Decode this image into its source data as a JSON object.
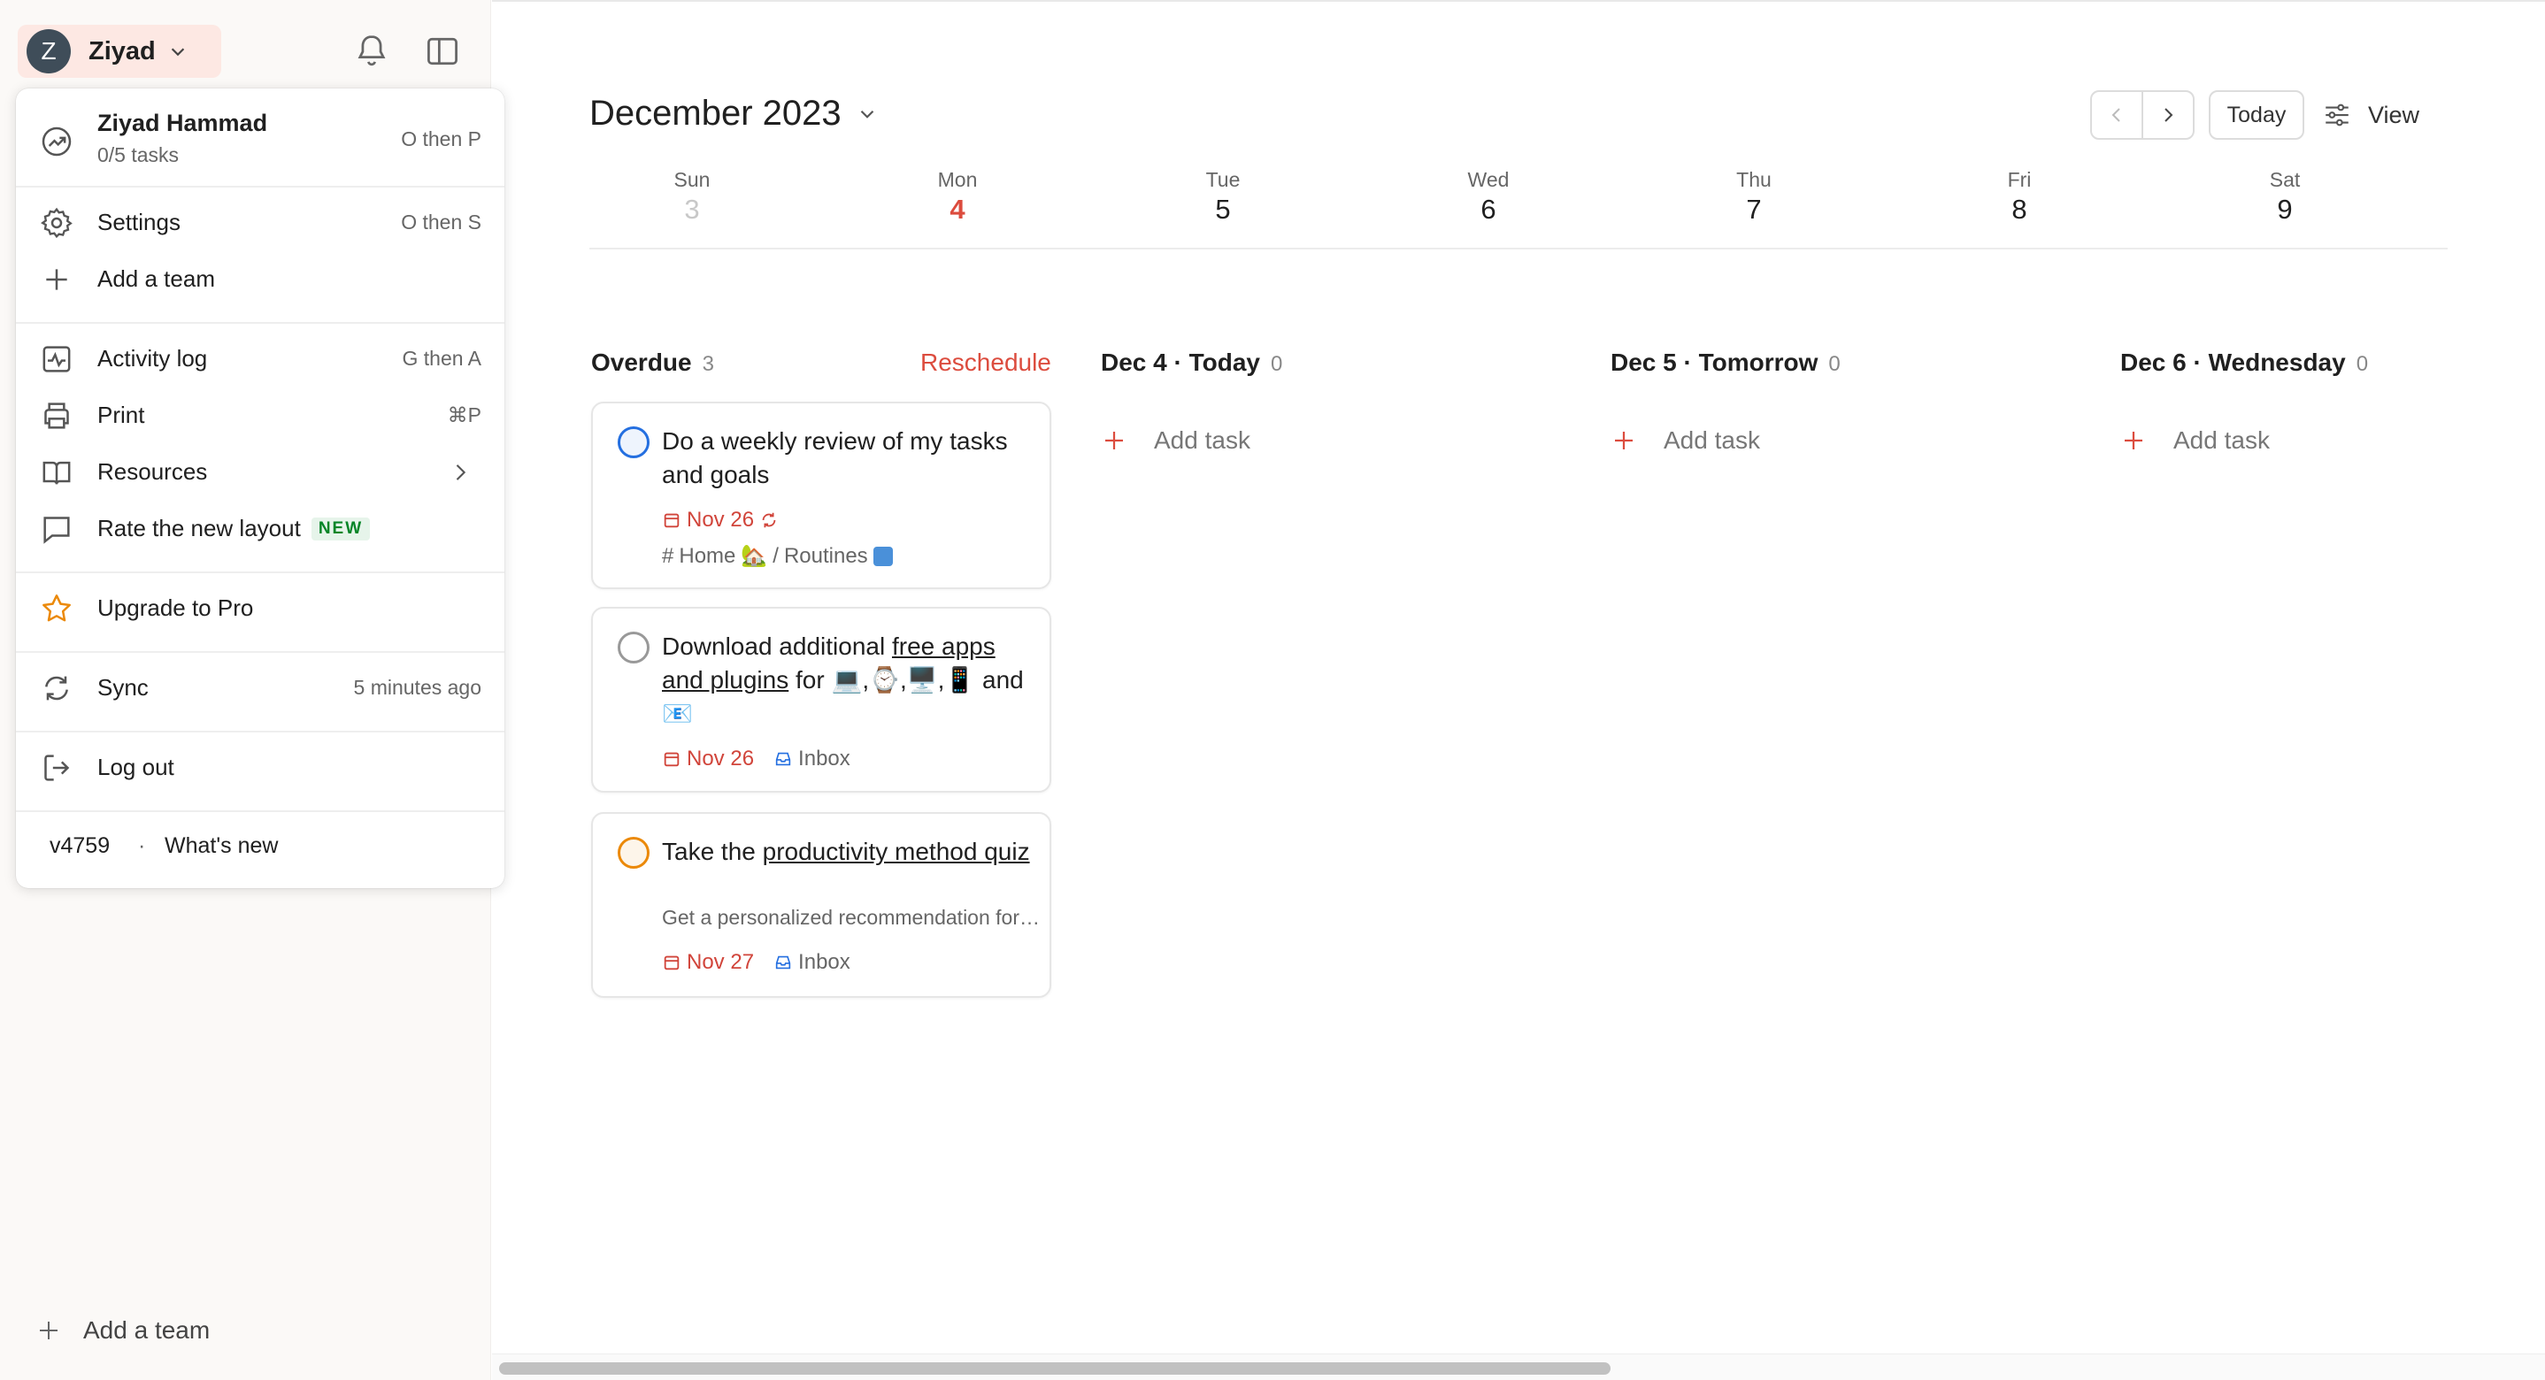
{
  "sidebar": {
    "user": {
      "initial": "Z",
      "name": "Ziyad"
    },
    "add_team_label": "Add a team"
  },
  "menu": {
    "profile": {
      "name": "Ziyad Hammad",
      "tasks": "0/5 tasks",
      "shortcut": "O then P"
    },
    "settings": {
      "label": "Settings",
      "shortcut": "O then S"
    },
    "add_team": {
      "label": "Add a team"
    },
    "activity_log": {
      "label": "Activity log",
      "shortcut": "G then A"
    },
    "print": {
      "label": "Print",
      "shortcut": "⌘P"
    },
    "resources": {
      "label": "Resources"
    },
    "rate_layout": {
      "label": "Rate the new layout",
      "badge": "NEW"
    },
    "upgrade": {
      "label": "Upgrade to Pro"
    },
    "sync": {
      "label": "Sync",
      "status": "5 minutes ago"
    },
    "logout": {
      "label": "Log out"
    },
    "version": "v4759",
    "dot": "·",
    "whats_new": "What's new"
  },
  "header": {
    "month": "December 2023",
    "today_label": "Today",
    "view_label": "View"
  },
  "week": [
    {
      "name": "Sun",
      "date": "3"
    },
    {
      "name": "Mon",
      "date": "4"
    },
    {
      "name": "Tue",
      "date": "5"
    },
    {
      "name": "Wed",
      "date": "6"
    },
    {
      "name": "Thu",
      "date": "7"
    },
    {
      "name": "Fri",
      "date": "8"
    },
    {
      "name": "Sat",
      "date": "9"
    }
  ],
  "columns": {
    "overdue": {
      "title": "Overdue",
      "count": "3",
      "action": "Reschedule"
    },
    "today": {
      "title": "Dec 4 · Today",
      "count": "0",
      "add_label": "Add task"
    },
    "tomorrow": {
      "title": "Dec 5 · Tomorrow",
      "count": "0",
      "add_label": "Add task"
    },
    "wednesday": {
      "title": "Dec 6 · Wednesday",
      "count": "0",
      "add_label": "Add task"
    }
  },
  "tasks": [
    {
      "title": "Do a weekly review of my tasks and goals",
      "date": "Nov 26",
      "project_hash": "#",
      "project": "Home",
      "separator": "/",
      "section": "Routines",
      "priority_color": "#246fe0"
    },
    {
      "title_pre": "Download additional ",
      "title_link": "free apps and plugins",
      "title_post": " for 💻,⌚,🖥️,📱 and 📧",
      "date": "Nov 26",
      "project": "Inbox"
    },
    {
      "title_pre": "Take the ",
      "title_link": "productivity method quiz",
      "description": "Get a personalized recommendation for a productivity method",
      "date": "Nov 27",
      "project": "Inbox",
      "priority_color": "#eb8909"
    }
  ],
  "colors": {
    "accent": "#dc4c3e",
    "priority_1": "#246fe0",
    "priority_2": "#eb8909"
  }
}
